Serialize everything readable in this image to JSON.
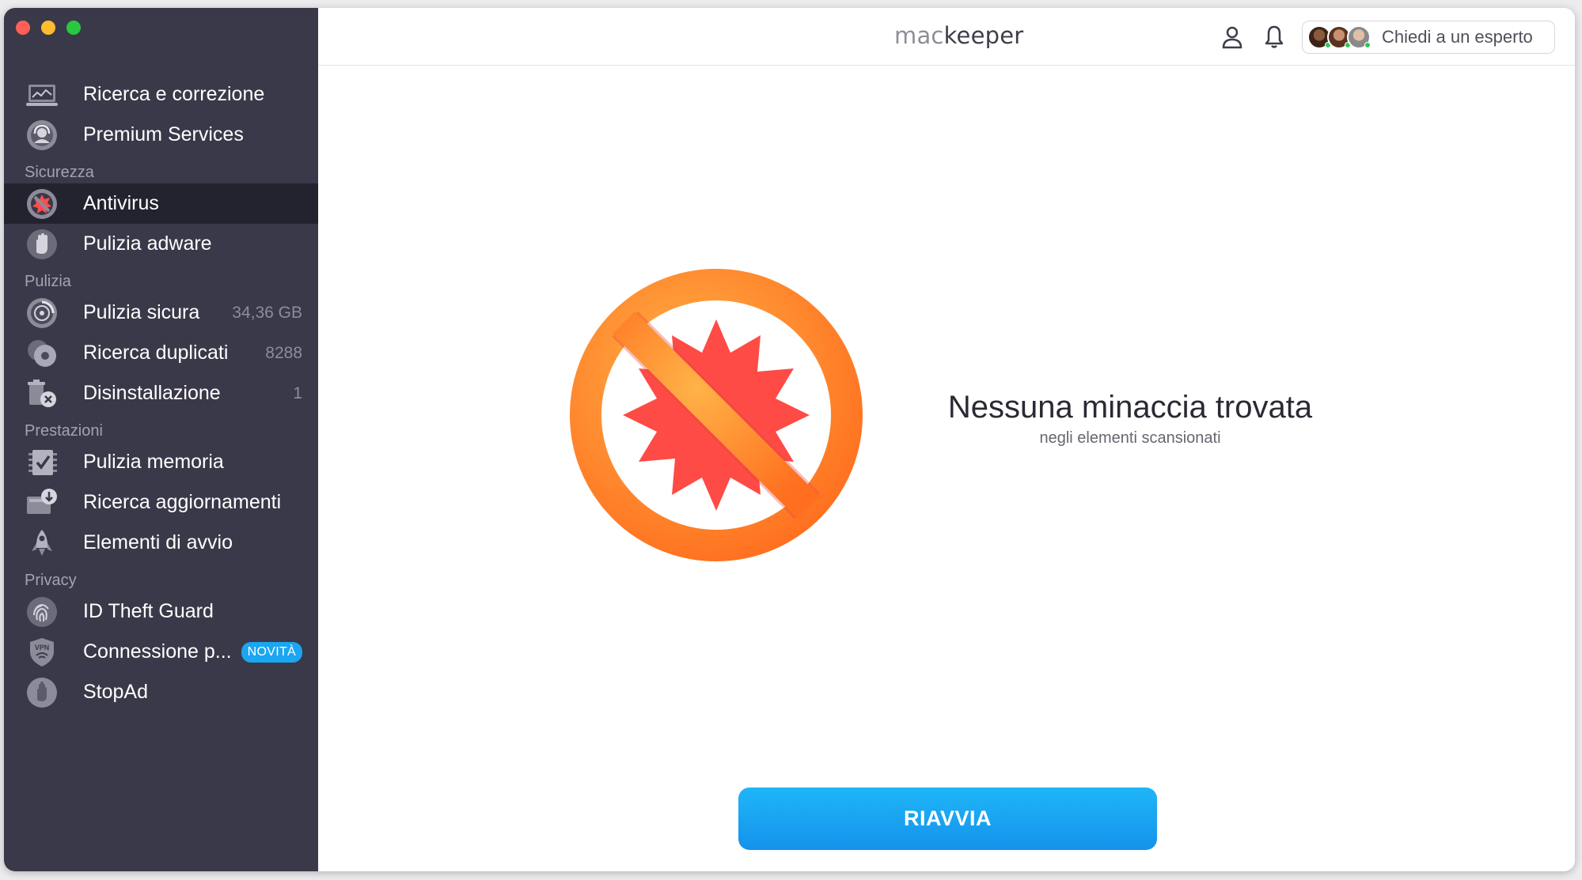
{
  "app": {
    "logo_part1": "mac",
    "logo_part2": "keeper",
    "brand_color": "#1aa6f0"
  },
  "header": {
    "expert_button_label": "Chiedi a un esperto",
    "icons": [
      "user-icon",
      "bell-icon"
    ]
  },
  "sidebar": {
    "top_items": [
      {
        "label": "Ricerca e correzione",
        "icon": "laptop-scan-icon"
      },
      {
        "label": "Premium Services",
        "icon": "support-headset-icon"
      }
    ],
    "sections": [
      {
        "title": "Sicurezza",
        "items": [
          {
            "label": "Antivirus",
            "icon": "antivirus-icon",
            "active": true
          },
          {
            "label": "Pulizia adware",
            "icon": "hand-stop-icon"
          }
        ]
      },
      {
        "title": "Pulizia",
        "items": [
          {
            "label": "Pulizia sicura",
            "icon": "disk-clean-icon",
            "count": "34,36 GB"
          },
          {
            "label": "Ricerca duplicati",
            "icon": "duplicates-icon",
            "count": "8288"
          },
          {
            "label": "Disinstallazione",
            "icon": "uninstall-icon",
            "count": "1"
          }
        ]
      },
      {
        "title": "Prestazioni",
        "items": [
          {
            "label": "Pulizia memoria",
            "icon": "memory-check-icon"
          },
          {
            "label": "Ricerca aggiornamenti",
            "icon": "update-download-icon"
          },
          {
            "label": "Elementi di avvio",
            "icon": "rocket-icon"
          }
        ]
      },
      {
        "title": "Privacy",
        "items": [
          {
            "label": "ID Theft Guard",
            "icon": "fingerprint-icon"
          },
          {
            "label": "Connessione p...",
            "icon": "vpn-shield-icon",
            "badge": "NOVITÀ"
          },
          {
            "label": "StopAd",
            "icon": "stop-hand-icon"
          }
        ]
      }
    ]
  },
  "main": {
    "result_title": "Nessuna minaccia trovata",
    "result_subtitle": "negli elementi scansionati",
    "restart_button": "RIAVVIA"
  }
}
